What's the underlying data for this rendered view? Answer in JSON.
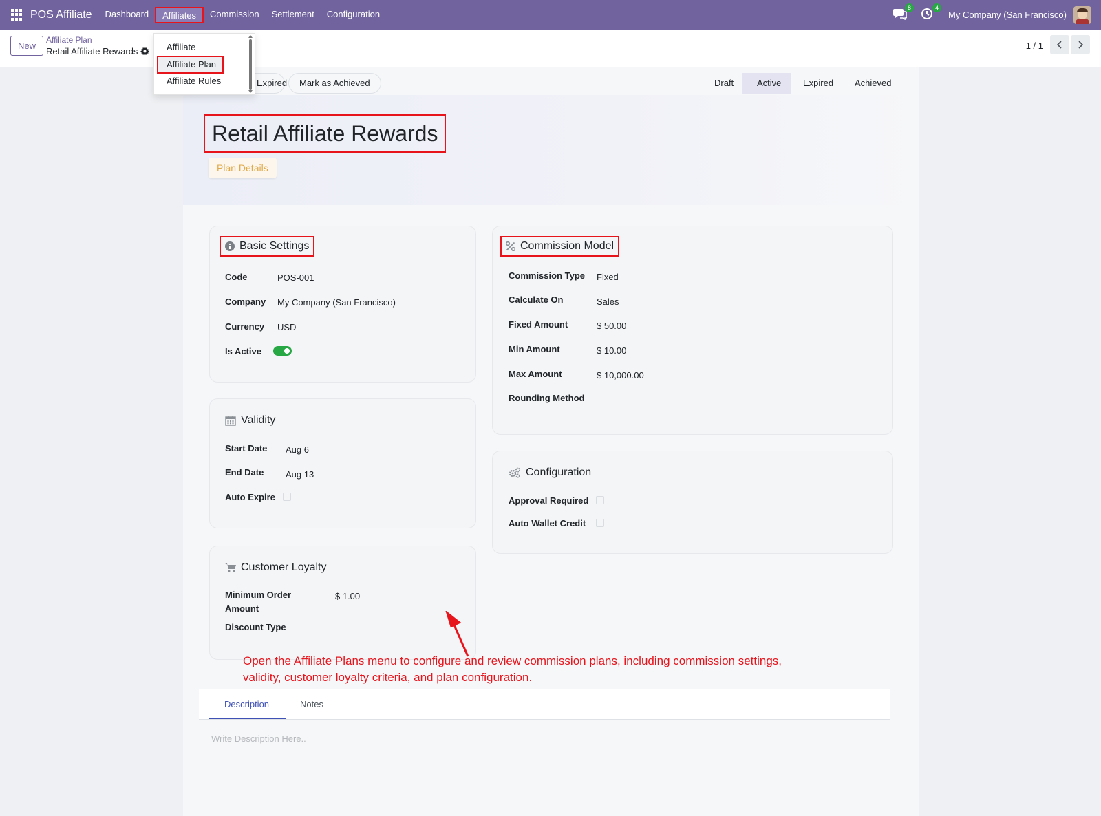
{
  "navbar": {
    "brand": "POS Affiliate",
    "menu": [
      "Dashboard",
      "Affiliates",
      "Commission",
      "Settlement",
      "Configuration"
    ],
    "messages_badge": "8",
    "activity_badge": "4",
    "company": "My Company (San Francisco)"
  },
  "control": {
    "new_label": "New",
    "breadcrumb_parent": "Affiliate Plan",
    "breadcrumb_current": "Retail Affiliate Rewards",
    "pager": "1 / 1"
  },
  "dropdown": {
    "items": [
      "Affiliate",
      "Affiliate Plan",
      "Affiliate Rules"
    ]
  },
  "statusbar": {
    "expired_btn": "Expired",
    "achieved_btn": "Mark as Achieved",
    "stages": [
      "Draft",
      "Active",
      "Expired",
      "Achieved"
    ]
  },
  "header": {
    "title": "Retail Affiliate Rewards",
    "plan_details": "Plan Details"
  },
  "basic": {
    "title": "Basic Settings",
    "code_label": "Code",
    "code": "POS-001",
    "company_label": "Company",
    "company": "My Company (San Francisco)",
    "currency_label": "Currency",
    "currency": "USD",
    "active_label": "Is Active",
    "is_active": true
  },
  "validity": {
    "title": "Validity",
    "start_label": "Start Date",
    "start": "Aug 6",
    "end_label": "End Date",
    "end": "Aug 13",
    "auto_expire_label": "Auto Expire"
  },
  "loyalty": {
    "title": "Customer Loyalty",
    "min_order_label_1": "Minimum Order",
    "min_order_label_2": "Amount",
    "min_order": "$ 1.00",
    "discount_label": "Discount Type"
  },
  "commission": {
    "title": "Commission Model",
    "type_label": "Commission Type",
    "type": "Fixed",
    "calc_label": "Calculate On",
    "calc": "Sales",
    "fixed_label": "Fixed Amount",
    "fixed": "$ 50.00",
    "min_label": "Min Amount",
    "min": "$ 10.00",
    "max_label": "Max Amount",
    "max": "$ 10,000.00",
    "rounding_label": "Rounding Method"
  },
  "configuration": {
    "title": "Configuration",
    "approval_label": "Approval Required",
    "wallet_label": "Auto Wallet Credit"
  },
  "annotation": {
    "line1": "Open the Affiliate Plans menu to configure and review commission plans, including commission settings,",
    "line2": "validity, customer loyalty criteria, and plan configuration."
  },
  "tabs": {
    "description": "Description",
    "notes": "Notes",
    "placeholder": "Write Description Here.."
  },
  "colors": {
    "navbar": "#71639e",
    "highlight": "#e8141c",
    "toggle_on": "#28a745",
    "tab_active": "#3f51b5"
  }
}
